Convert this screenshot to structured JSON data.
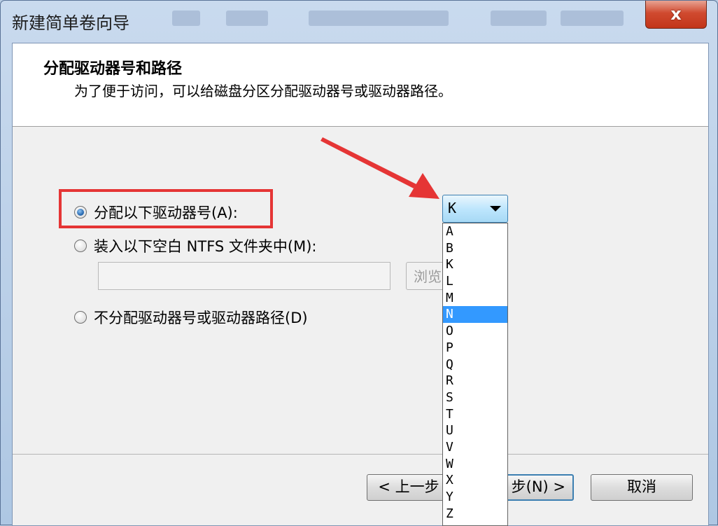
{
  "window": {
    "title": "新建简单卷向导",
    "close_label": "x"
  },
  "header": {
    "title": "分配驱动器号和路径",
    "subtitle": "为了便于访问，可以给磁盘分区分配驱动器号或驱动器路径。"
  },
  "options": {
    "assign_letter": "分配以下驱动器号(A):",
    "mount_folder": "装入以下空白 NTFS 文件夹中(M):",
    "no_assign": "不分配驱动器号或驱动器路径(D)",
    "browse_label": "浏览"
  },
  "drive_combo": {
    "selected": "K",
    "items": [
      "A",
      "B",
      "K",
      "L",
      "M",
      "N",
      "O",
      "P",
      "Q",
      "R",
      "S",
      "T",
      "U",
      "V",
      "W",
      "X",
      "Y",
      "Z"
    ],
    "highlighted": "N"
  },
  "buttons": {
    "back": "< 上一步",
    "next": "步(N) >",
    "cancel": "取消"
  },
  "colors": {
    "annotation_red": "#e53535",
    "selection_blue": "#3399ff"
  }
}
